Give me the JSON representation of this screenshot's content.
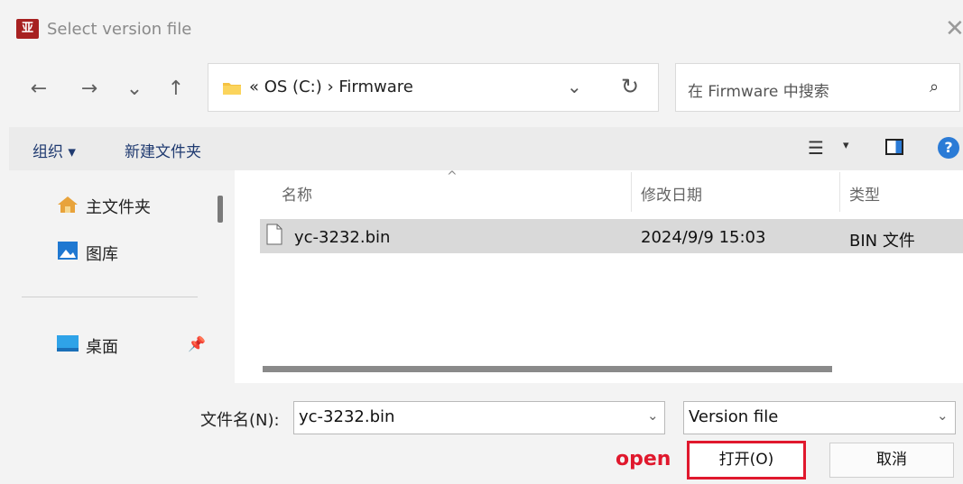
{
  "window": {
    "title": "Select version file",
    "app_icon_text": "亚",
    "close_glyph": "✕"
  },
  "nav": {
    "back": "←",
    "forward": "→",
    "recent": "⌄",
    "up": "↑"
  },
  "address": {
    "crumbs": "«  OS (C:)  ›  Firmware",
    "chevron": "⌄",
    "refresh": "↻"
  },
  "search": {
    "placeholder": "在 Firmware 中搜索",
    "icon": "⌕"
  },
  "toolbar": {
    "organize": "组织 ▾",
    "new_folder": "新建文件夹",
    "view_icon": "☰",
    "view_caret": "▾",
    "help": "?"
  },
  "sidebar": {
    "items": [
      {
        "label": "主文件夹",
        "icon": "home-icon"
      },
      {
        "label": "图库",
        "icon": "gallery-icon"
      },
      {
        "label": "桌面",
        "icon": "desktop-icon"
      }
    ],
    "pin": "📌"
  },
  "columns": {
    "name": "名称",
    "modified": "修改日期",
    "type": "类型",
    "sort_caret": "^"
  },
  "files": [
    {
      "name": "yc-3232.bin",
      "modified": "2024/9/9 15:03",
      "type": "BIN 文件"
    }
  ],
  "footer": {
    "filename_label": "文件名(N):",
    "filename_value": "yc-3232.bin",
    "filetype_value": "Version file",
    "chevron": "⌄",
    "annotation": "open",
    "open_label": "打开(O)",
    "cancel_label": "取消"
  },
  "colors": {
    "annotation_red": "#e0182d",
    "accent_blue": "#2b7bd6",
    "app_icon_red": "#a72121"
  }
}
